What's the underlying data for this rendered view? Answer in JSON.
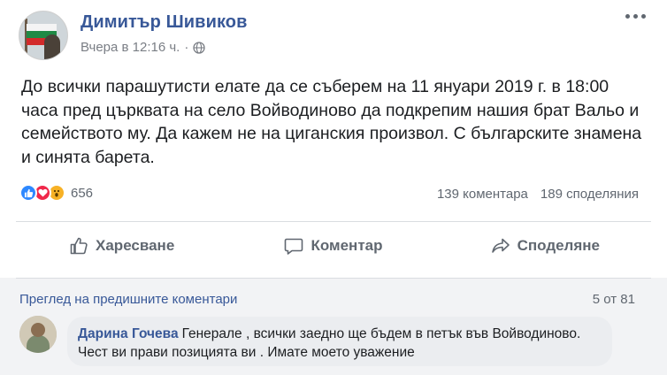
{
  "post": {
    "author": "Димитър Шивиков",
    "time": "Вчера в 12:16 ч.",
    "separator": "·",
    "privacy_icon": "globe-icon",
    "more_icon": "more-options-icon",
    "text": "До всички парашутисти елате да се съберем на 11 януари 2019 г. в 18:00 часа пред църквата на село Войводиново да подкрепим нашия брат Вальо и семейството му. Да кажем не на циганския произвол. С българските знамена и синята барета."
  },
  "reactions": {
    "icons": [
      "like-icon",
      "love-icon",
      "wow-icon"
    ],
    "count": "656",
    "comments": "139 коментара",
    "shares": "189 споделяния",
    "colors": {
      "like": "#2d88ff",
      "love": "#f0284a",
      "wow": "#f7b125"
    }
  },
  "actions": {
    "like": "Харесване",
    "comment": "Коментар",
    "share": "Споделяне"
  },
  "comments": {
    "view_previous": "Преглед на предишните коментари",
    "count": "5 от 81",
    "items": [
      {
        "author": "Дарина Гочева",
        "text": "Генерале , всички заедно ще бъдем в петък във Войводиново. Чест ви прави позицията ви . Имате моето уважение"
      }
    ]
  },
  "colors": {
    "link": "#385898",
    "secondary_text": "#606770",
    "comment_bubble": "#ebedf0"
  }
}
